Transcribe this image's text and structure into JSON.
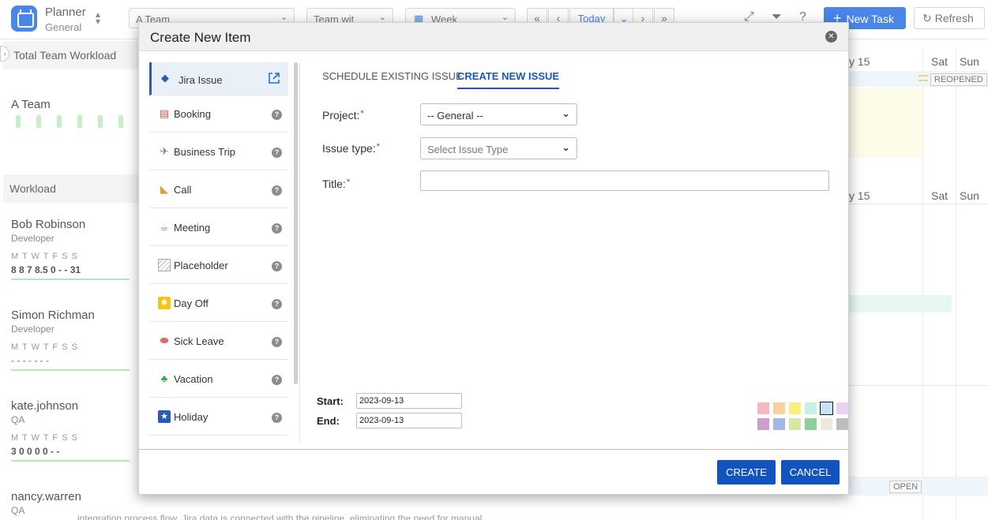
{
  "app": {
    "title": "Planner",
    "subtitle": "General",
    "team_select": "A Team",
    "filter_select": "Team wit",
    "view_select": "Week",
    "today_label": "Today",
    "new_task_label": "New Task",
    "refresh_label": "Refresh"
  },
  "left": {
    "total_workload_label": "Total Team Workload",
    "team_name": "A Team",
    "workload_label": "Workload",
    "people": [
      {
        "name": "Bob Robinson",
        "role": "Developer",
        "days": "M  T  W     T   F  S  S",
        "values": "8  8  7   8.5  0  -  -   31"
      },
      {
        "name": "Simon Richman",
        "role": "Developer",
        "days": "M     T     W     T   F   S   S",
        "values": "-     -     -     -   -   -   -"
      },
      {
        "name": "kate.johnson",
        "role": "QA",
        "days": "M     T     W     T   F   S   S",
        "values": "3     0     0     0   0   -   -"
      },
      {
        "name": "nancy.warren",
        "role": "QA"
      }
    ]
  },
  "grid": {
    "day_partial": "y 15",
    "sat": "Sat",
    "sun": "Sun",
    "status_reopened": "REOPENED",
    "status_open": "OPEN",
    "bottom_text": "integration process flow, Jira data is connected with the pipeline, eliminating the need for manual"
  },
  "modal": {
    "title": "Create New Item",
    "types": [
      {
        "label": "Jira Issue",
        "icon": "jira-icon"
      },
      {
        "label": "Booking",
        "icon": "booking-icon"
      },
      {
        "label": "Business Trip",
        "icon": "airplane-icon"
      },
      {
        "label": "Call",
        "icon": "bell-icon"
      },
      {
        "label": "Meeting",
        "icon": "coffee-icon"
      },
      {
        "label": "Placeholder",
        "icon": "placeholder-icon"
      },
      {
        "label": "Day Off",
        "icon": "sun-icon"
      },
      {
        "label": "Sick Leave",
        "icon": "pill-icon"
      },
      {
        "label": "Vacation",
        "icon": "beach-icon"
      },
      {
        "label": "Holiday",
        "icon": "star-icon"
      }
    ],
    "tabs": {
      "schedule_existing": "SCHEDULE EXISTING ISSUE",
      "create_new": "CREATE NEW ISSUE"
    },
    "form": {
      "project_label": "Project:",
      "project_value": "-- General --",
      "issue_type_label": "Issue type:",
      "issue_type_value": "Select Issue Type",
      "title_label": "Title:",
      "title_value": "",
      "required_mark": "*"
    },
    "dates": {
      "start_label": "Start:",
      "start_value": "2023-09-13",
      "end_label": "End:",
      "end_value": "2023-09-13"
    },
    "colors": [
      "#f7b7c0",
      "#fbd39a",
      "#f6f07e",
      "#c5f0e4",
      "#c9e3f5",
      "#ead2f7",
      "#cf9dcb",
      "#9fb8e6",
      "#d6e6a4",
      "#8fcf9b",
      "#efe8dd",
      "#bdbdbd"
    ],
    "selected_color": "#c9e3f5",
    "create_label": "CREATE",
    "cancel_label": "CANCEL"
  }
}
